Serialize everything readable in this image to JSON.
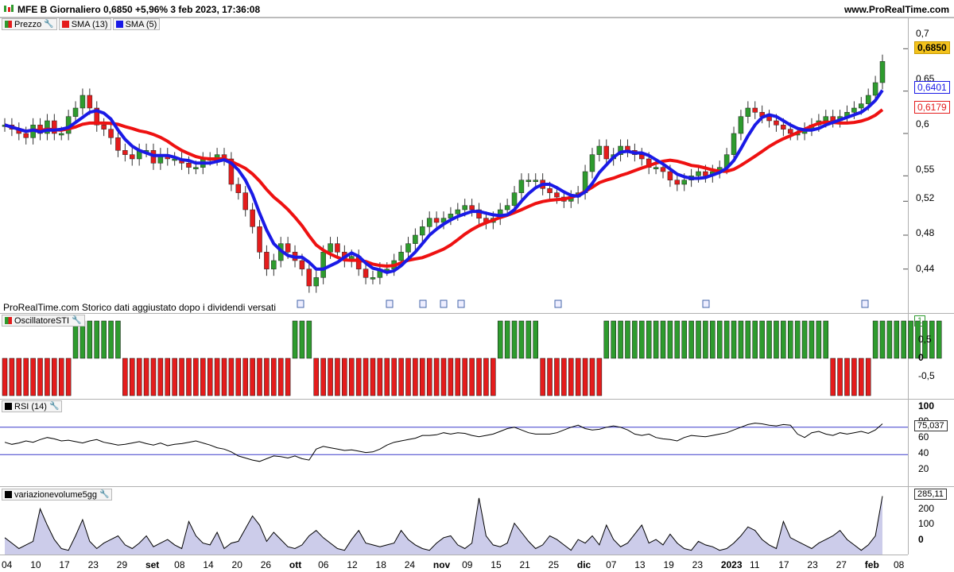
{
  "title": "MFE B Giornaliero 0,6850 +5,96% 3 feb 2023, 17:36:08",
  "site": "www.ProRealTime.com",
  "note": "ProRealTime.com  Storico dati aggiustato dopo i dividendi versati",
  "colors": {
    "up": "#2e9b2e",
    "down": "#e41c1c",
    "sma13": "#ee1111",
    "sma5": "#1a1ae6",
    "rsi_band": "#3a3acc",
    "vol_fill": "#ccccea"
  },
  "price_pane": {
    "legend": [
      {
        "name": "Prezzo",
        "color": "#2e9b2e",
        "icon": "candles-icon"
      },
      {
        "name": "SMA (13)",
        "color": "#e41c1c",
        "icon": "settings-wrench-icon"
      },
      {
        "name": "SMA (5)",
        "color": "#1a1ae6"
      }
    ],
    "ticks": [
      "0,7",
      "0,65",
      "0,6",
      "0,55",
      "0,52",
      "0,48",
      "0,44"
    ],
    "last_price": "0,6850",
    "sma5_value": "0,6401",
    "sma13_value": "0,6179"
  },
  "sti_pane": {
    "legend": "OscillatoreSTI",
    "ticks": [
      "0,5",
      "0",
      "-0,5"
    ],
    "value": "1"
  },
  "rsi_pane": {
    "legend": "RSI (14)",
    "ticks": [
      "100",
      "80",
      "60",
      "40",
      "20"
    ],
    "value": "75,037"
  },
  "vol_pane": {
    "legend": "variazionevolume5gg",
    "ticks": [
      "285,11",
      "200",
      "100",
      "0"
    ],
    "value": "285,11"
  },
  "x_axis": [
    "04",
    "10",
    "17",
    "23",
    "29",
    "set",
    "08",
    "14",
    "20",
    "26",
    "ott",
    "06",
    "12",
    "18",
    "24",
    "nov",
    "09",
    "15",
    "21",
    "25",
    "dic",
    "07",
    "13",
    "19",
    "23",
    "2023",
    "11",
    "17",
    "23",
    "27",
    "feb",
    "08"
  ],
  "chart_data": {
    "type": "candlestick",
    "title": "MFE B Giornaliero",
    "close_series": [
      0.61,
      0.605,
      0.6,
      0.595,
      0.61,
      0.6,
      0.615,
      0.6,
      0.6,
      0.62,
      0.63,
      0.645,
      0.63,
      0.61,
      0.605,
      0.595,
      0.58,
      0.575,
      0.57,
      0.58,
      0.58,
      0.565,
      0.575,
      0.57,
      0.57,
      0.565,
      0.56,
      0.56,
      0.57,
      0.57,
      0.575,
      0.57,
      0.54,
      0.53,
      0.51,
      0.49,
      0.46,
      0.44,
      0.45,
      0.47,
      0.46,
      0.45,
      0.44,
      0.42,
      0.43,
      0.46,
      0.47,
      0.46,
      0.45,
      0.455,
      0.44,
      0.43,
      0.43,
      0.44,
      0.44,
      0.45,
      0.46,
      0.47,
      0.48,
      0.49,
      0.5,
      0.495,
      0.5,
      0.505,
      0.51,
      0.515,
      0.51,
      0.5,
      0.495,
      0.5,
      0.51,
      0.515,
      0.53,
      0.545,
      0.545,
      0.545,
      0.535,
      0.53,
      0.525,
      0.52,
      0.525,
      0.53,
      0.555,
      0.575,
      0.585,
      0.57,
      0.575,
      0.585,
      0.58,
      0.575,
      0.57,
      0.56,
      0.56,
      0.555,
      0.545,
      0.54,
      0.545,
      0.55,
      0.555,
      0.55,
      0.555,
      0.56,
      0.575,
      0.6,
      0.62,
      0.63,
      0.625,
      0.62,
      0.615,
      0.61,
      0.605,
      0.6,
      0.6,
      0.605,
      0.61,
      0.615,
      0.62,
      0.615,
      0.62,
      0.625,
      0.63,
      0.635,
      0.645,
      0.66,
      0.685
    ],
    "sma13_last": 0.6179,
    "sma5_last": 0.6401,
    "last": 0.685,
    "ylim": [
      0.42,
      0.72
    ],
    "sti": [
      -1,
      -1,
      -1,
      -1,
      -1,
      -1,
      -1,
      -1,
      -1,
      -1,
      1,
      1,
      1,
      1,
      1,
      1,
      1,
      -1,
      -1,
      -1,
      -1,
      -1,
      -1,
      -1,
      -1,
      -1,
      -1,
      -1,
      -1,
      -1,
      -1,
      -1,
      -1,
      -1,
      -1,
      -1,
      -1,
      -1,
      -1,
      -1,
      -1,
      1,
      1,
      1,
      -1,
      -1,
      -1,
      -1,
      -1,
      -1,
      -1,
      -1,
      -1,
      -1,
      -1,
      -1,
      -1,
      -1,
      -1,
      -1,
      -1,
      -1,
      -1,
      -1,
      -1,
      -1,
      -1,
      -1,
      -1,
      -1,
      1,
      1,
      1,
      1,
      1,
      1,
      -1,
      -1,
      -1,
      -1,
      -1,
      -1,
      -1,
      -1,
      -1,
      1,
      1,
      1,
      1,
      1,
      1,
      1,
      1,
      1,
      1,
      1,
      1,
      1,
      1,
      1,
      1,
      1,
      1,
      1,
      1,
      1,
      1,
      1,
      1,
      1,
      1,
      1,
      1,
      1,
      1,
      1,
      1,
      -1,
      -1,
      -1,
      -1,
      -1,
      -1,
      1,
      1,
      1,
      1,
      1,
      1,
      1,
      1,
      1,
      1
    ],
    "rsi_range": [
      0,
      100
    ],
    "rsi_bands": [
      70,
      30
    ],
    "rsi": [
      48,
      45,
      47,
      50,
      48,
      52,
      55,
      53,
      50,
      51,
      49,
      47,
      50,
      52,
      48,
      46,
      44,
      45,
      47,
      49,
      46,
      44,
      47,
      43,
      45,
      46,
      48,
      50,
      47,
      44,
      40,
      38,
      34,
      28,
      25,
      22,
      20,
      24,
      28,
      27,
      25,
      28,
      24,
      22,
      38,
      42,
      40,
      38,
      36,
      37,
      35,
      33,
      34,
      38,
      44,
      48,
      50,
      52,
      54,
      58,
      58,
      59,
      62,
      60,
      62,
      61,
      58,
      56,
      58,
      60,
      64,
      68,
      70,
      66,
      62,
      60,
      60,
      60,
      62,
      66,
      70,
      73,
      68,
      66,
      67,
      70,
      72,
      70,
      66,
      60,
      58,
      60,
      55,
      53,
      52,
      50,
      55,
      58,
      57,
      56,
      58,
      60,
      62,
      66,
      70,
      74,
      76,
      75,
      73,
      72,
      74,
      73,
      60,
      55,
      62,
      64,
      60,
      58,
      62,
      60,
      62,
      64,
      61,
      66,
      75
    ],
    "vol_range": [
      -30,
      300
    ],
    "vol": [
      50,
      20,
      -10,
      10,
      30,
      210,
      120,
      40,
      -10,
      -20,
      60,
      150,
      30,
      -10,
      20,
      40,
      60,
      10,
      -10,
      20,
      60,
      0,
      20,
      40,
      10,
      -10,
      140,
      60,
      20,
      10,
      80,
      -10,
      20,
      30,
      100,
      170,
      120,
      30,
      80,
      40,
      0,
      -10,
      10,
      60,
      90,
      50,
      20,
      -10,
      -20,
      40,
      90,
      20,
      10,
      0,
      10,
      20,
      90,
      40,
      10,
      -10,
      -20,
      20,
      50,
      60,
      10,
      -10,
      20,
      270,
      60,
      10,
      0,
      20,
      130,
      80,
      30,
      -10,
      10,
      60,
      40,
      10,
      -20,
      40,
      20,
      60,
      10,
      120,
      40,
      0,
      20,
      70,
      120,
      20,
      40,
      10,
      70,
      20,
      -10,
      -20,
      30,
      10,
      0,
      -20,
      -10,
      20,
      60,
      110,
      90,
      40,
      10,
      -10,
      140,
      50,
      30,
      10,
      -10,
      20,
      40,
      60,
      90,
      40,
      10,
      -20,
      10,
      60,
      280
    ]
  }
}
